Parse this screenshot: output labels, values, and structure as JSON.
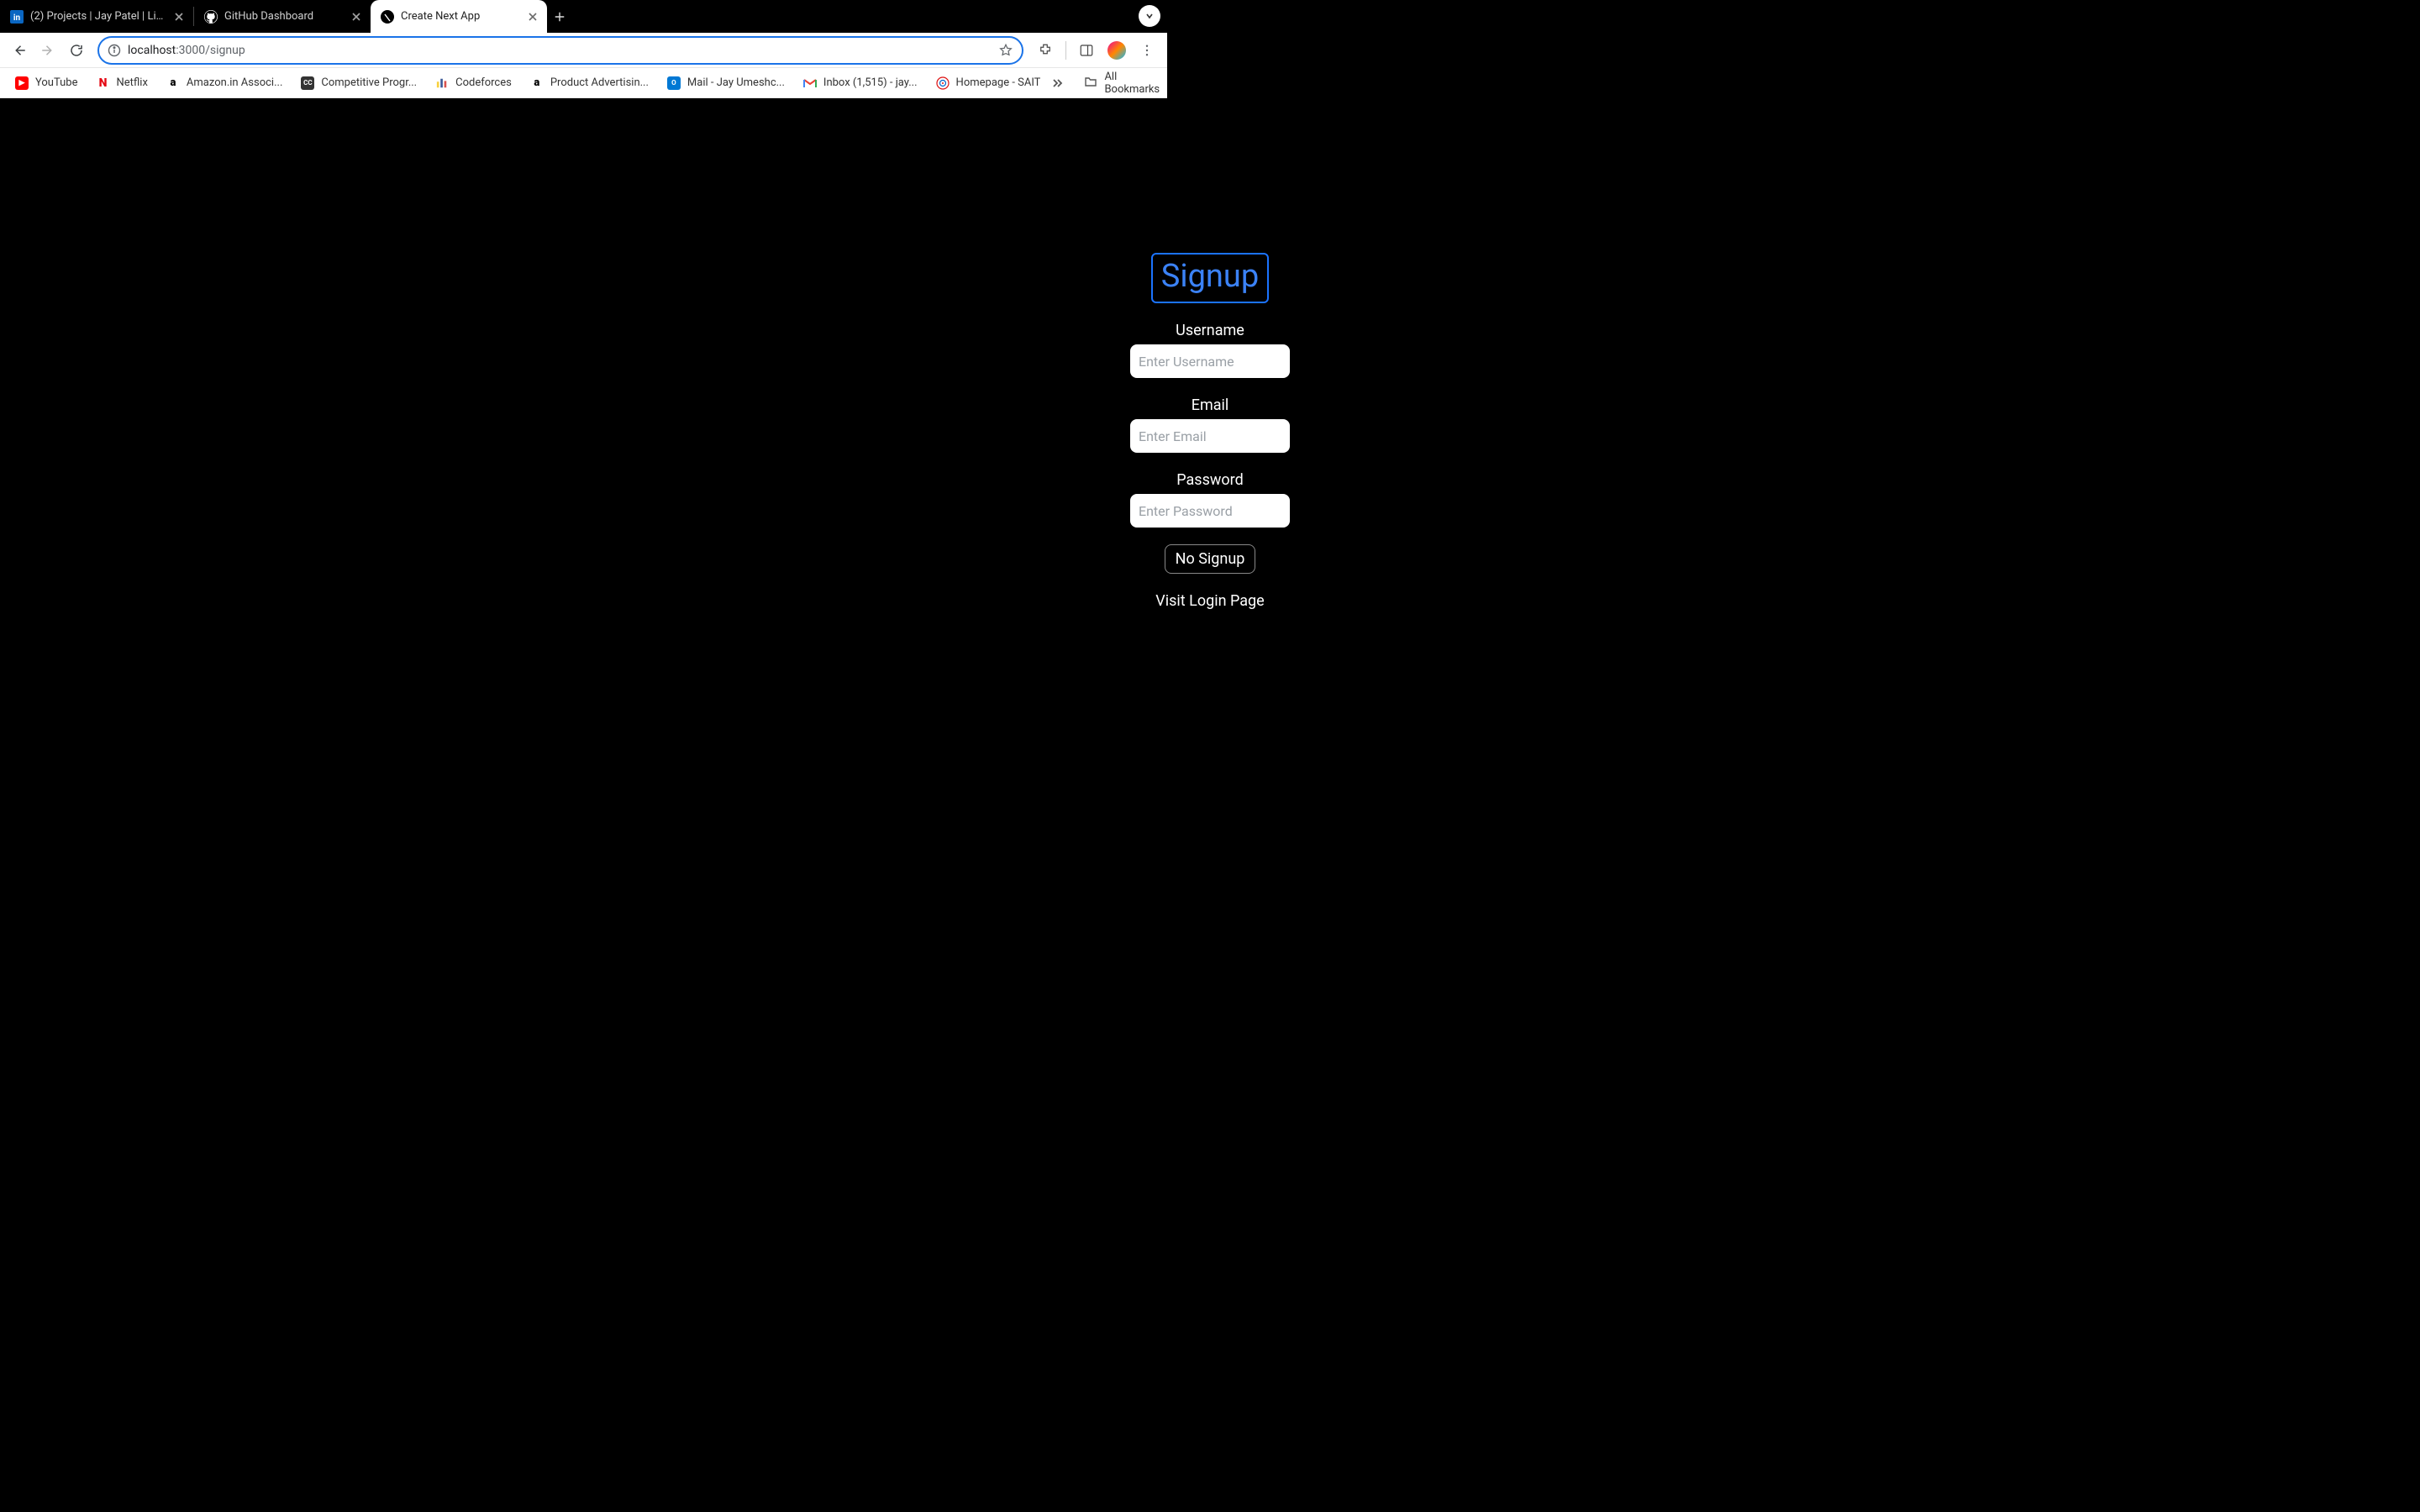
{
  "browser": {
    "tabs": [
      {
        "title": "(2) Projects | Jay Patel | Linke",
        "active": false,
        "favicon": "linkedin"
      },
      {
        "title": "GitHub Dashboard",
        "active": false,
        "favicon": "github"
      },
      {
        "title": "Create Next App",
        "active": true,
        "favicon": "next"
      }
    ],
    "url_host": "localhost",
    "url_rest": ":3000/signup",
    "bookmarks": [
      {
        "label": "YouTube",
        "icon": "youtube"
      },
      {
        "label": "Netflix",
        "icon": "netflix"
      },
      {
        "label": "Amazon.in Associ...",
        "icon": "amazon"
      },
      {
        "label": "Competitive Progr...",
        "icon": "cc"
      },
      {
        "label": "Codeforces",
        "icon": "codeforces"
      },
      {
        "label": "Product Advertisin...",
        "icon": "amazon"
      },
      {
        "label": "Mail - Jay Umeshc...",
        "icon": "outlook"
      },
      {
        "label": "Inbox (1,515) - jay...",
        "icon": "gmail"
      },
      {
        "label": "Homepage - SAIT",
        "icon": "sait"
      }
    ],
    "all_bookmarks_label": "All Bookmarks"
  },
  "page": {
    "heading": "Signup",
    "username_label": "Username",
    "username_placeholder": "Enter Username",
    "email_label": "Email",
    "email_placeholder": "Enter Email",
    "password_label": "Password",
    "password_placeholder": "Enter Password",
    "submit_label": "No Signup",
    "login_link_label": "Visit Login Page"
  }
}
